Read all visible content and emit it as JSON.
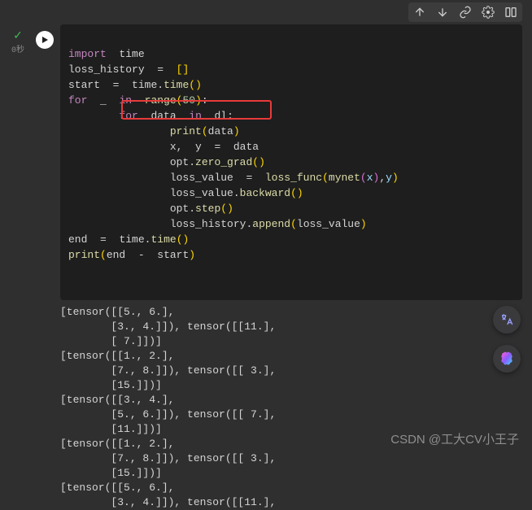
{
  "gutter": {
    "check": "✓",
    "time": "0秒"
  },
  "code": {
    "l1": {
      "k_import": "import",
      "mod": "time"
    },
    "l2": {
      "lhs": "loss_history",
      "eq": "=",
      "br": "[]"
    },
    "l3": {
      "lhs": "start",
      "eq": "=",
      "obj": "time",
      "dot": ".",
      "fn": "time",
      "par": "()"
    },
    "l4": {
      "k_for": "for",
      "v": "_",
      "k_in": "in",
      "fn": "range",
      "lp": "(",
      "n": "50",
      "rp": ")",
      "colon": ":"
    },
    "l5": {
      "k_for": "for",
      "v": "data",
      "k_in": "in",
      "it": "dl",
      "colon": ":"
    },
    "l6": {
      "fn": "print",
      "lp": "(",
      "arg": "data",
      "rp": ")"
    },
    "l7": {
      "lhs": "x,  y",
      "eq": "=",
      "rhs": "data"
    },
    "l8": {
      "obj": "opt",
      "dot": ".",
      "fn": "zero_grad",
      "par": "()"
    },
    "l9": {
      "lhs": "loss_value",
      "eq": "=",
      "fn": "loss_func",
      "lp": "(",
      "call": "mynet",
      "lp2": "(",
      "x": "x",
      "rp2": ")",
      "comma": ",",
      "y": "y",
      "rp": ")"
    },
    "l10": {
      "obj": "loss_value",
      "dot": ".",
      "fn": "backward",
      "par": "()"
    },
    "l11": {
      "obj": "opt",
      "dot": ".",
      "fn": "step",
      "par": "()"
    },
    "l12": {
      "obj": "loss_history",
      "dot": ".",
      "fn": "append",
      "lp": "(",
      "arg": "loss_value",
      "rp": ")"
    },
    "l13": {
      "lhs": "end",
      "eq": "=",
      "obj": "time",
      "dot": ".",
      "fn": "time",
      "par": "()"
    },
    "l14": {
      "fn": "print",
      "lp": "(",
      "a": "end",
      "op": "-",
      "b": "start",
      "rp": ")"
    }
  },
  "output_lines": [
    "[tensor([[5., 6.],",
    "        [3., 4.]]), tensor([[11.],",
    "        [ 7.]])]",
    "[tensor([[1., 2.],",
    "        [7., 8.]]), tensor([[ 3.],",
    "        [15.]])]",
    "[tensor([[3., 4.],",
    "        [5., 6.]]), tensor([[ 7.],",
    "        [11.]])]",
    "[tensor([[1., 2.],",
    "        [7., 8.]]), tensor([[ 3.],",
    "        [15.]])]",
    "[tensor([[5., 6.],",
    "        [3., 4.]]), tensor([[11.],"
  ],
  "watermark": "CSDN @工大CV小王子"
}
